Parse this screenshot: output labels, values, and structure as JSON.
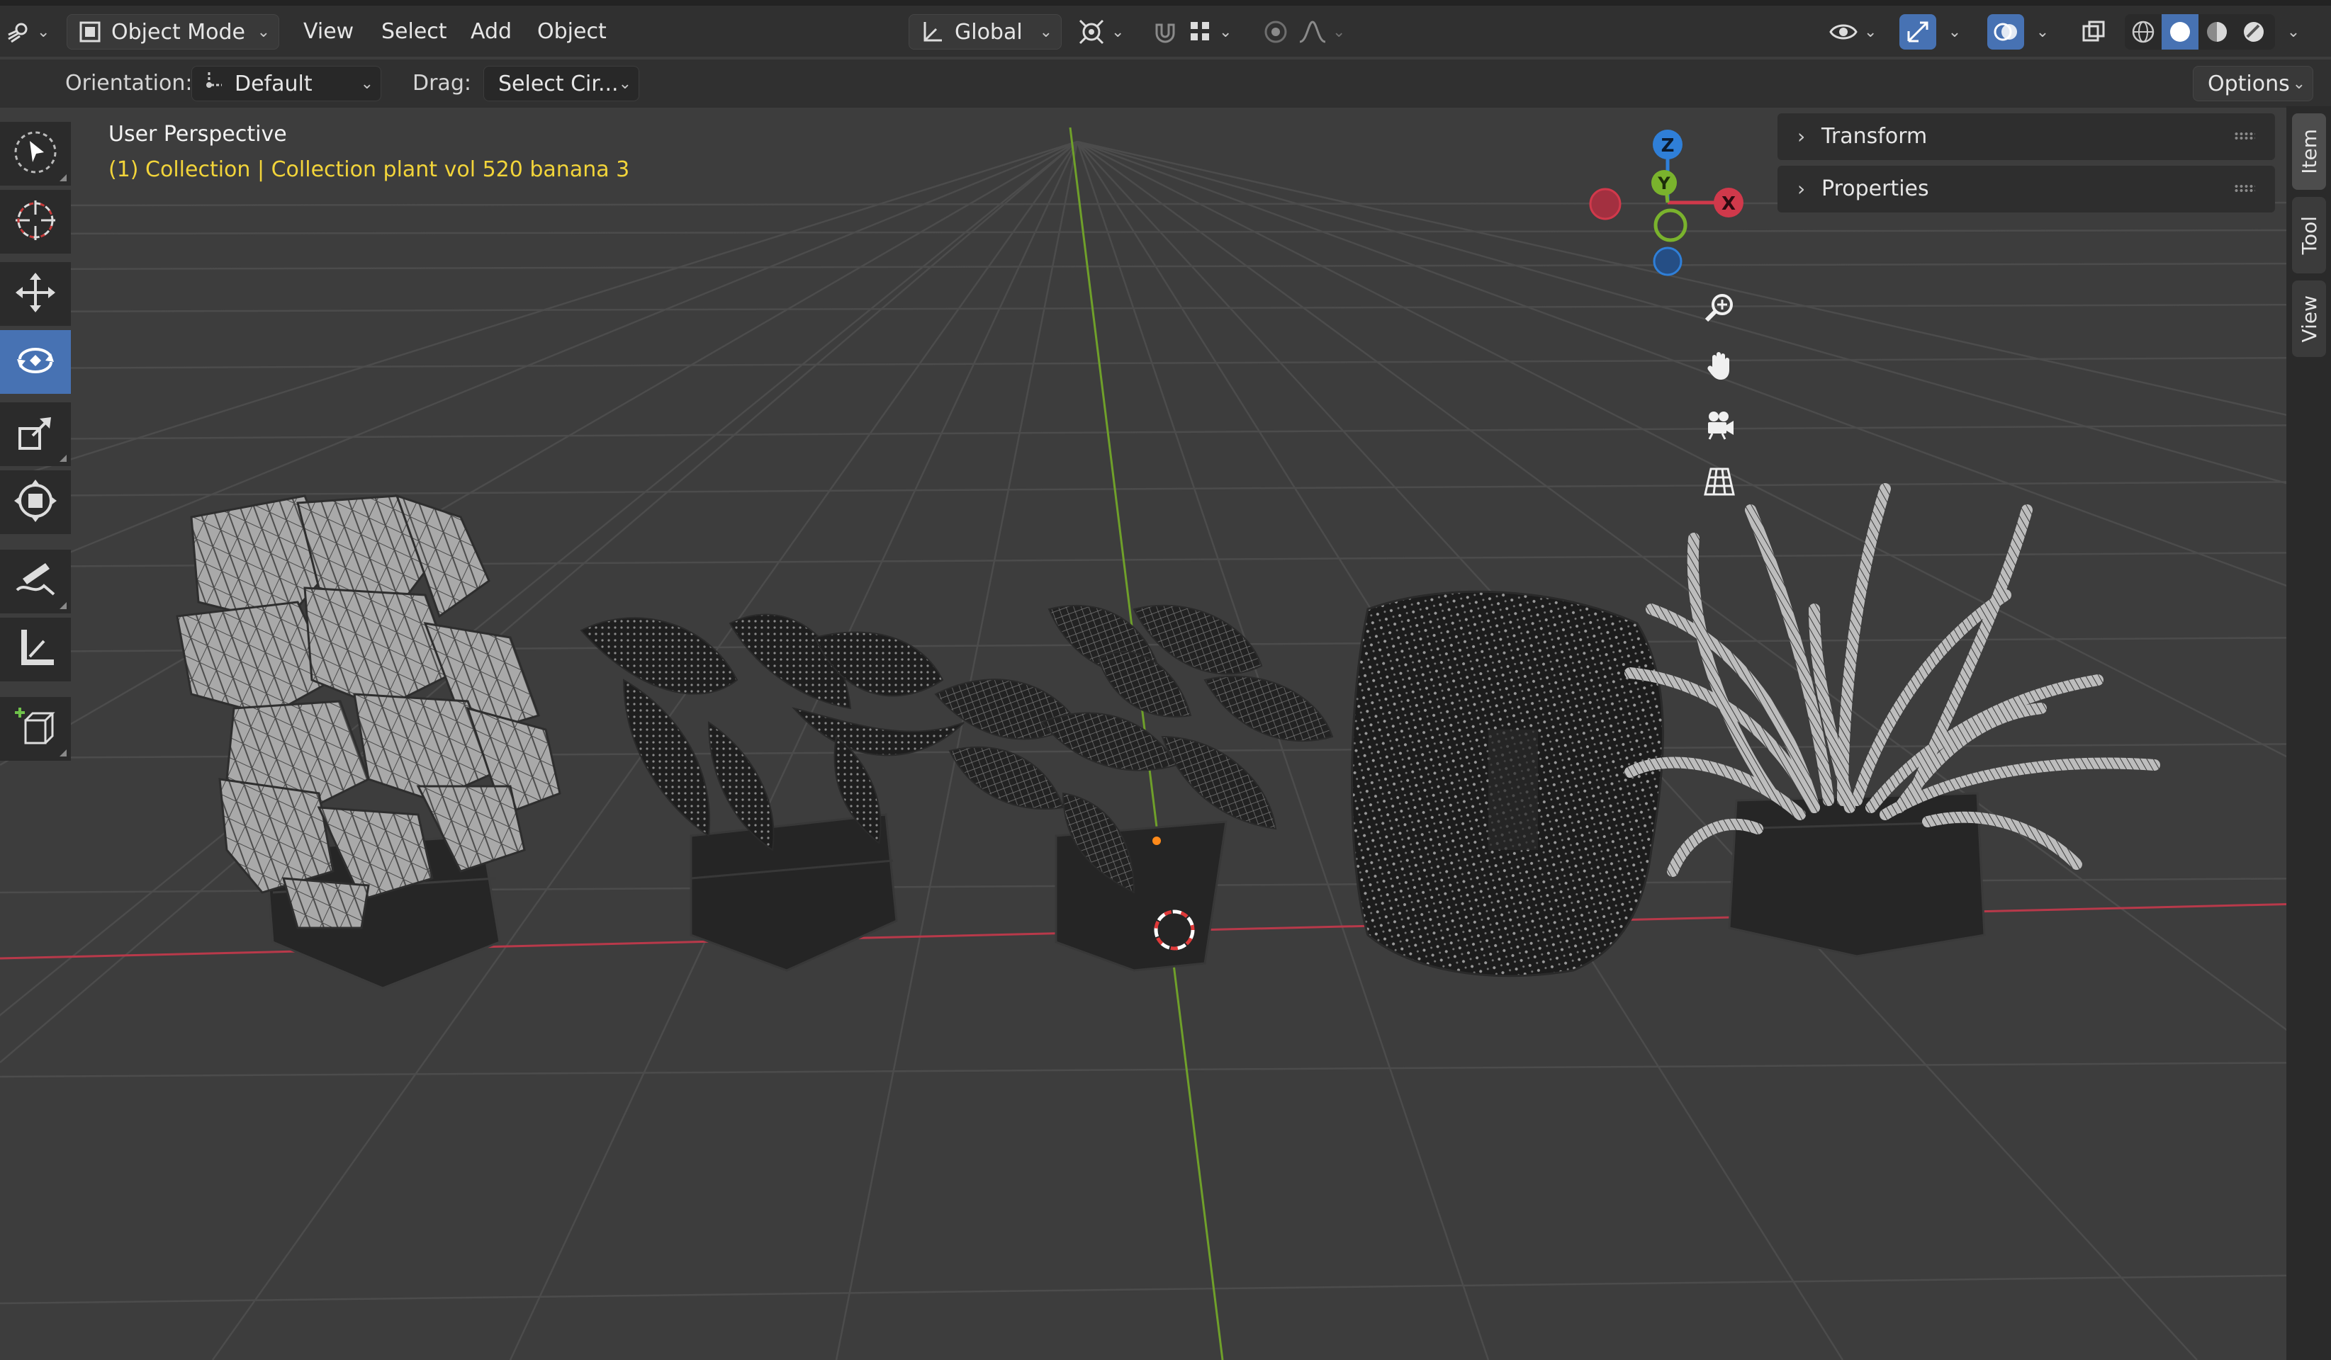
{
  "header": {
    "editor_type_icon": "editor-type-icon",
    "mode_label": "Object Mode",
    "menus": [
      "View",
      "Select",
      "Add",
      "Object"
    ],
    "transform_orientation": "Global",
    "pivot_icon": "pivot-point-icon",
    "snap_icon": "snap-magnet-icon",
    "snap_target_icon": "snap-increment-icon",
    "proportional_icon": "proportional-edit-icon",
    "falloff_icon": "falloff-curve-icon",
    "visibility_icon": "visibility-eye-icon",
    "gizmo_icon": "gizmo-toggle-icon",
    "overlay_icon": "overlays-icon",
    "xray_icon": "xray-toggle-icon",
    "shading_modes": [
      "wireframe",
      "solid",
      "material-preview",
      "rendered"
    ],
    "active_shading": "solid"
  },
  "tool_settings": {
    "orientation_label": "Orientation:",
    "orientation_value": "Default",
    "drag_label": "Drag:",
    "drag_value": "Select Cir...",
    "options_label": "Options"
  },
  "toolbar": [
    {
      "name": "select-box-tool",
      "icon": "cursor-arrow-icon",
      "active": false
    },
    {
      "name": "cursor-tool",
      "icon": "3d-cursor-icon",
      "active": false
    },
    {
      "name": "move-tool",
      "icon": "move-arrows-icon",
      "active": false
    },
    {
      "name": "rotate-tool",
      "icon": "rotate-icon",
      "active": true
    },
    {
      "name": "scale-tool",
      "icon": "scale-icon",
      "active": false
    },
    {
      "name": "transform-tool",
      "icon": "transform-icon",
      "active": false
    },
    {
      "name": "annotate-tool",
      "icon": "annotate-pen-icon",
      "active": false
    },
    {
      "name": "measure-tool",
      "icon": "measure-ruler-icon",
      "active": false
    },
    {
      "name": "add-cube-tool",
      "icon": "add-cube-icon",
      "active": false
    }
  ],
  "viewport": {
    "title": "User Perspective",
    "collection_text": "(1) Collection | Collection plant vol 520 banana 3",
    "axis_labels": {
      "z": "Z",
      "y": "Y",
      "x": "X"
    },
    "colors": {
      "x_axis": "#d0394b",
      "y_axis": "#7ab32d",
      "z_axis": "#2f7fd8",
      "collection_text": "#f2d43a",
      "active_tool": "#4772b3"
    }
  },
  "navigation": [
    "zoom-icon",
    "pan-hand-icon",
    "camera-view-icon",
    "ortho-grid-icon"
  ],
  "sidebar": {
    "panels": [
      "Transform",
      "Properties"
    ],
    "tabs": [
      "Item",
      "Tool",
      "View"
    ],
    "active_tab": "Item"
  }
}
